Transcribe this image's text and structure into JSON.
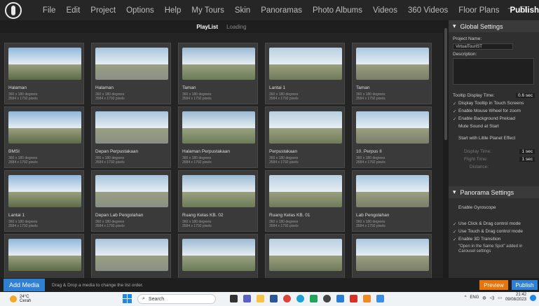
{
  "menu": {
    "items": [
      "File",
      "Edit",
      "Project",
      "Options",
      "Help",
      "My Tours",
      "Skin",
      "Panoramas",
      "Photo Albums",
      "Videos",
      "360 Videos",
      "Floor Plans"
    ],
    "active": "Publish",
    "window_controls": [
      "–",
      "▢"
    ]
  },
  "subtabs": {
    "playlist": "PlayList",
    "loading": "Loading"
  },
  "panoramas": [
    {
      "name": "Halaman",
      "deg": "360 x 180 degrees",
      "px": "3584 x 1792 pixels"
    },
    {
      "name": "Halaman",
      "deg": "360 x 180 degrees",
      "px": "3584 x 1792 pixels"
    },
    {
      "name": "Taman",
      "deg": "360 x 180 degrees",
      "px": "3584 x 1792 pixels"
    },
    {
      "name": "Lantai 1",
      "deg": "360 x 180 degrees",
      "px": "3584 x 1792 pixels"
    },
    {
      "name": "Taman",
      "deg": "360 x 180 degrees",
      "px": "3584 x 1792 pixels"
    },
    {
      "name": "BMSI",
      "deg": "360 x 180 degrees",
      "px": "3584 x 1792 pixels"
    },
    {
      "name": "Depan Perpustakaan",
      "deg": "360 x 180 degrees",
      "px": "3584 x 1792 pixels"
    },
    {
      "name": "Halaman Perpustakaan",
      "deg": "360 x 180 degrees",
      "px": "3584 x 1792 pixels"
    },
    {
      "name": "Perpustakaan",
      "deg": "360 x 180 degrees",
      "px": "3584 x 1792 pixels"
    },
    {
      "name": "10. Perpus II",
      "deg": "360 x 180 degrees",
      "px": "3584 x 1792 pixels"
    },
    {
      "name": "Lantai 1",
      "deg": "360 x 180 degrees",
      "px": "3584 x 1792 pixels"
    },
    {
      "name": "Depan Lab Pengolahan",
      "deg": "360 x 180 degrees",
      "px": "3584 x 1792 pixels"
    },
    {
      "name": "Ruang Kelas KB. 02",
      "deg": "360 x 180 degrees",
      "px": "3584 x 1792 pixels"
    },
    {
      "name": "Ruang Kelas KB. 01",
      "deg": "360 x 180 degrees",
      "px": "3584 x 1792 pixels"
    },
    {
      "name": "Lab Pengolahan",
      "deg": "360 x 180 degrees",
      "px": "3584 x 1792 pixels"
    },
    {
      "name": "",
      "deg": "",
      "px": ""
    },
    {
      "name": "",
      "deg": "",
      "px": ""
    },
    {
      "name": "",
      "deg": "",
      "px": ""
    },
    {
      "name": "",
      "deg": "",
      "px": ""
    },
    {
      "name": "",
      "deg": "",
      "px": ""
    }
  ],
  "global": {
    "title": "Global Settings",
    "project_name_label": "Project Name:",
    "project_name": "VirtualTourIST",
    "description_label": "Description:",
    "tooltip_time_label": "Tooltip Display Time:",
    "tooltip_time": "0.6 sec",
    "options": [
      {
        "label": "Display Tooltip in Touch Screens",
        "checked": true
      },
      {
        "label": "Enable Mouse Wheel for zoom",
        "checked": true
      },
      {
        "label": "Enable Background Preload",
        "checked": true
      },
      {
        "label": "Mute Sound at Start",
        "checked": false
      }
    ],
    "planet_label": "Start with Little Planet Effect",
    "display_time_label": "Display Time:",
    "display_time": "1 sec",
    "flight_time_label": "Flight Time:",
    "flight_time": "1 sec",
    "distance_label": "Distance:"
  },
  "pano_settings": {
    "title": "Panorama Settings",
    "options": [
      {
        "label": "Enable Gyroscope",
        "checked": false
      },
      {
        "label": "Use Click & Drag control mode",
        "checked": true
      },
      {
        "label": "Use Touch & Drag control mode",
        "checked": true
      },
      {
        "label": "Enable 3D Transition",
        "checked": true
      }
    ],
    "note": "\"Open in the Same Spot\" added in Carousel settings"
  },
  "bottom": {
    "add_media": "Add Media",
    "hint": "Drag & Drop a media to change the list order.",
    "preview": "Preview",
    "publish": "Publish"
  },
  "taskbar": {
    "temp": "24°C",
    "weather": "Cerah",
    "search": "Search",
    "lang": "ENG",
    "time": "21:42",
    "date": "09/08/2023"
  },
  "colors": {
    "accent": "#2f7fd3",
    "preview": "#e8740c"
  }
}
